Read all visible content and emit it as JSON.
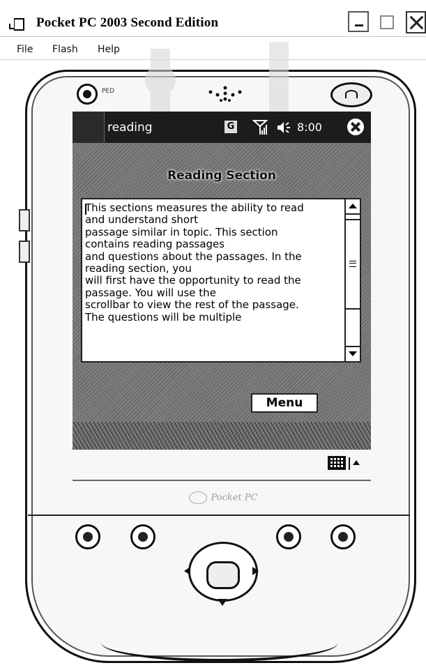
{
  "window": {
    "title": "Pocket PC 2003 Second Edition",
    "minimize_icon": "minimize-icon",
    "maximize_icon": "maximize-icon",
    "close_icon": "close-icon"
  },
  "menubar": {
    "items": [
      {
        "label": "File"
      },
      {
        "label": "Flash"
      },
      {
        "label": "Help"
      }
    ]
  },
  "device": {
    "led_label": "PED",
    "brand": "Pocket PC"
  },
  "screen": {
    "navbar": {
      "title": "reading",
      "badge": "G",
      "clock": "8:00",
      "icons": [
        "start-icon",
        "signal-icon",
        "volume-icon",
        "close-circle-icon"
      ]
    },
    "heading": "Reading Section",
    "passage": "This sections measures the ability to read\nand understand short\npassage similar in topic. This section\ncontains reading passages\nand questions about the passages. In the\nreading section, you\nwill first have the opportunity to read the\npassage. You will use the\nscrollbar to view the rest of the passage.\nThe questions will be multiple",
    "menu_button": "Menu",
    "sip_icon": "keyboard-icon"
  },
  "colors": {
    "nav_bar": "#1c1c1c",
    "screen_bg": "#6e6e6e",
    "panel_bg": "#ffffff",
    "text": "#000000"
  }
}
